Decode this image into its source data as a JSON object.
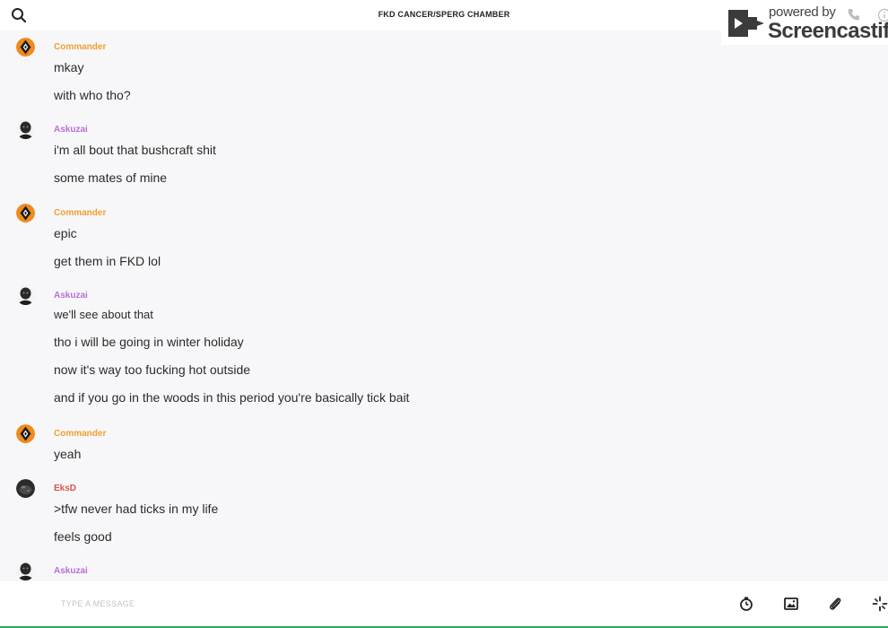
{
  "header": {
    "title": "FKD CANCER/SPERG CHAMBER",
    "search_icon": "search-icon"
  },
  "watermark": {
    "powered_by": "powered by",
    "brand": "Screencastify"
  },
  "messages": [
    {
      "author": "Commander",
      "author_color": "#f0a030",
      "avatar": "commander-diamond-avatar",
      "lines": [
        "mkay",
        "with who tho?"
      ]
    },
    {
      "author": "Askuzai",
      "author_color": "#b96fd6",
      "avatar": "askuzai-dark-avatar",
      "lines": [
        "i'm all bout that bushcraft shit",
        "some mates of mine"
      ]
    },
    {
      "author": "Commander",
      "author_color": "#f0a030",
      "avatar": "commander-diamond-avatar",
      "lines": [
        "epic",
        "get them in FKD lol"
      ]
    },
    {
      "author": "Askuzai",
      "author_color": "#b96fd6",
      "avatar": "askuzai-dark-avatar",
      "lines": [
        "we'll see about that",
        "tho i will be going in winter holiday",
        "now it's way too fucking hot outside",
        "and if you go in the woods in this period you're basically tick bait"
      ]
    },
    {
      "author": "Commander",
      "author_color": "#f0a030",
      "avatar": "commander-diamond-avatar",
      "lines": [
        "yeah"
      ]
    },
    {
      "author": "EksD",
      "author_color": "#d9534f",
      "avatar": "eksd-dark-avatar",
      "lines": [
        ">tfw never had ticks in my life",
        "feels good"
      ]
    },
    {
      "author": "Askuzai",
      "author_color": "#b96fd6",
      "avatar": "askuzai-dark-avatar",
      "lines": []
    }
  ],
  "composer": {
    "placeholder": "TYPE A MESSAGE",
    "tools": [
      "timer-icon",
      "image-icon",
      "attachment-icon",
      "more-icon"
    ]
  },
  "colors": {
    "accent_orange": "#f0a030",
    "accent_purple": "#b96fd6",
    "accent_red": "#d9534f",
    "background": "#f7f7f9"
  }
}
